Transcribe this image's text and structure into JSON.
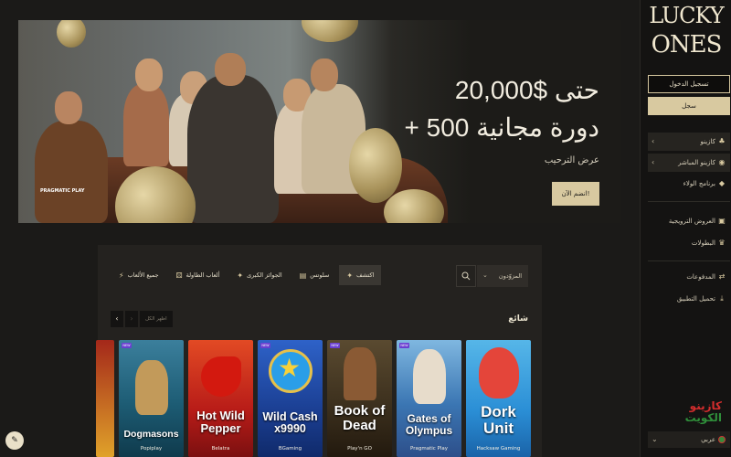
{
  "brand": {
    "line1": "LUCKY",
    "line2": "ONES"
  },
  "auth": {
    "login": "تسجيل الدخول",
    "register": "سجل"
  },
  "sidebar": {
    "items": [
      {
        "label": "كازينو",
        "icon": "cherries-icon"
      },
      {
        "label": "كازينو المباشر",
        "icon": "live-icon"
      },
      {
        "label": "برنامج الولاء",
        "icon": "diamond-icon"
      },
      {
        "label": "العروض الترويجية",
        "icon": "gift-icon"
      },
      {
        "label": "البطولات",
        "icon": "trophy-icon"
      },
      {
        "label": "المدفوعات",
        "icon": "transfer-icon"
      },
      {
        "label": "تحميل التطبيق",
        "icon": "download-icon"
      }
    ],
    "language": "عربي"
  },
  "hero": {
    "title": "حتى $20,000",
    "subtitle": "+ 500 دورة مجانية",
    "note": "عرض الترحيب",
    "cta": "انضم الآن!",
    "provider_logo": "PRAGMATIC PLAY"
  },
  "filters": {
    "chips": [
      {
        "label": "جميع الألعاب",
        "icon": "bolt-icon",
        "active": false
      },
      {
        "label": "ألعاب الطاولة",
        "icon": "dice-icon",
        "active": false
      },
      {
        "label": "الجوائز الكبرى",
        "icon": "sparkle-icon",
        "active": false
      },
      {
        "label": "سلوتس",
        "icon": "slot-icon",
        "active": false
      },
      {
        "label": "اكتشف",
        "icon": "sparkle-icon",
        "active": true
      }
    ],
    "provider_label": "المزوّدون"
  },
  "section": {
    "title": "شائع",
    "view_all": "اظهر الكل"
  },
  "games": [
    {
      "title": "",
      "provider": "",
      "colors": [
        "#a4281a",
        "#e0a22a"
      ]
    },
    {
      "title": "Dogmasons",
      "provider": "Popiplay",
      "colors": [
        "#1d6e88",
        "#e7c45a"
      ]
    },
    {
      "title": "Hot Wild Pepper",
      "provider": "Belatra",
      "colors": [
        "#c2231b",
        "#f59c2a"
      ]
    },
    {
      "title": "Wild Cash x9990",
      "provider": "BGaming",
      "colors": [
        "#1c4aa8",
        "#62b4ee"
      ]
    },
    {
      "title": "Book of Dead",
      "provider": "Play'n GO",
      "colors": [
        "#3a2e1c",
        "#a78a4a"
      ]
    },
    {
      "title": "Gates of Olympus",
      "provider": "Pragmatic Play",
      "colors": [
        "#2f66a8",
        "#9ad2f0"
      ]
    },
    {
      "title": "Dork Unit",
      "provider": "Hacksaw Gaming",
      "colors": [
        "#2b8fd6",
        "#6ad0ff"
      ]
    }
  ],
  "watermark": {
    "line1": "كازينو",
    "line2": "الكويت"
  }
}
